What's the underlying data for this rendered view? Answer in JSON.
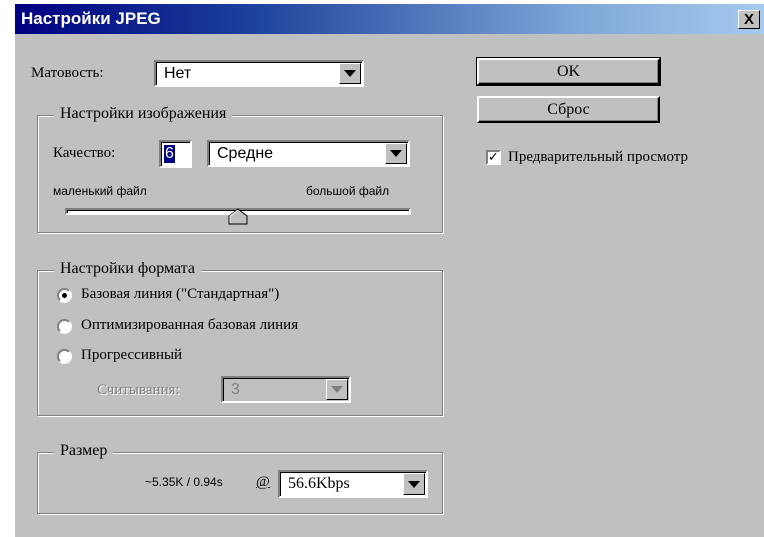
{
  "window": {
    "title": "Настройки JPEG",
    "close_label": "X"
  },
  "matte": {
    "label": "Матовость:",
    "value": "Нет"
  },
  "buttons": {
    "ok": "OK",
    "reset": "Сброс"
  },
  "preview": {
    "label": "Предварительный просмотр",
    "checked": true,
    "mark": "✓"
  },
  "image_settings": {
    "legend": "Настройки изображения",
    "quality_label": "Качество:",
    "quality_value": "6",
    "quality_preset": "Средне",
    "small_file_label": "маленький файл",
    "large_file_label": "большой файл",
    "slider_level": 0.5
  },
  "format_settings": {
    "legend": "Настройки формата",
    "options": [
      "Базовая линия (\"Стандартная\")",
      "Оптимизированная базовая линия",
      "Прогрессивный"
    ],
    "selected_index": 0,
    "scans_label": "Считывания:",
    "scans_value": "3"
  },
  "size": {
    "legend": "Размер",
    "estimate": "~5.35K / 0.94s",
    "at_label": "@",
    "speed": "56.6Kbps"
  }
}
